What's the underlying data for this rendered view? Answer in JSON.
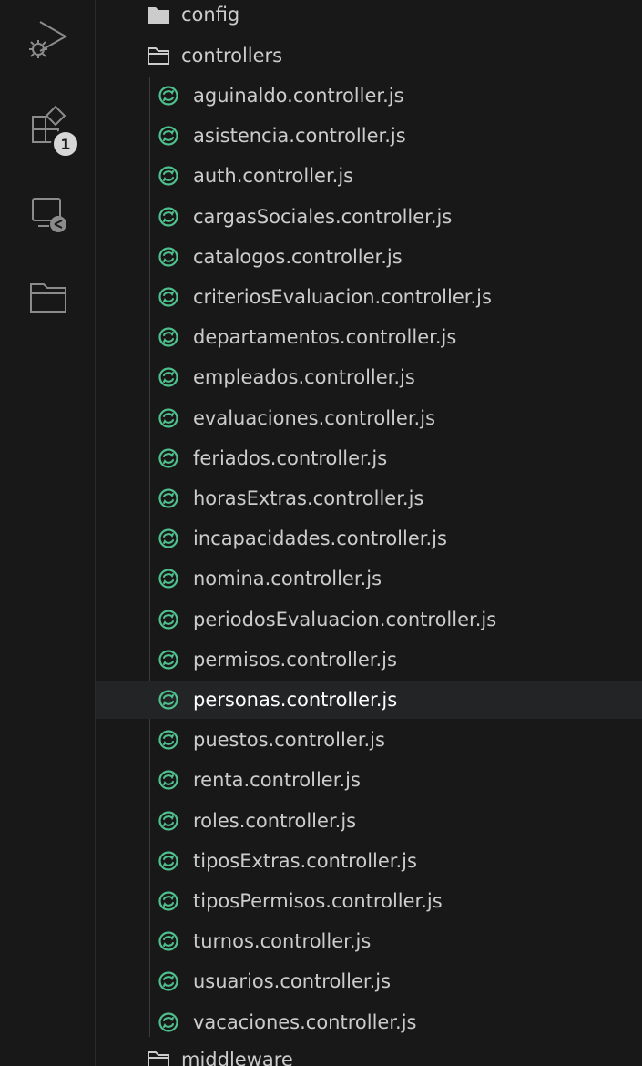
{
  "activity_bar": {
    "icons": [
      "run-debug-icon",
      "extensions-icon",
      "remote-explorer-icon",
      "explorer-icon"
    ],
    "extensions_badge": "1",
    "accent": "#cccccc"
  },
  "explorer": {
    "folders": {
      "config": "config",
      "controllers": "controllers",
      "middleware": "middleware"
    },
    "files": [
      "aguinaldo.controller.js",
      "asistencia.controller.js",
      "auth.controller.js",
      "cargasSociales.controller.js",
      "catalogos.controller.js",
      "criteriosEvaluacion.controller.js",
      "departamentos.controller.js",
      "empleados.controller.js",
      "evaluaciones.controller.js",
      "feriados.controller.js",
      "horasExtras.controller.js",
      "incapacidades.controller.js",
      "nomina.controller.js",
      "periodosEvaluacion.controller.js",
      "permisos.controller.js",
      "personas.controller.js",
      "puestos.controller.js",
      "renta.controller.js",
      "roles.controller.js",
      "tiposExtras.controller.js",
      "tiposPermisos.controller.js",
      "turnos.controller.js",
      "usuarios.controller.js",
      "vacaciones.controller.js"
    ],
    "selected_file": "personas.controller.js",
    "file_icon_color": "#4fc08d",
    "selected_row_color": "#222426"
  }
}
